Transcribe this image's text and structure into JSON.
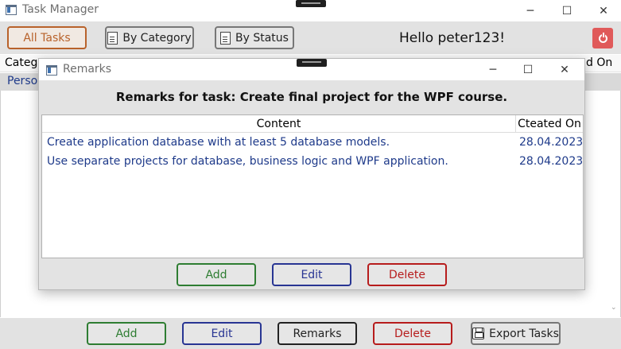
{
  "window": {
    "title": "Task Manager",
    "minimize_glyph": "─",
    "maximize_glyph": "☐",
    "close_glyph": "✕"
  },
  "toolbar": {
    "all_tasks": "All Tasks",
    "by_category": "By Category",
    "by_status": "By Status",
    "greeting": "Hello peter123!"
  },
  "main_grid": {
    "headers": [
      "Categ",
      "d On"
    ],
    "rows": [
      [
        "Person"
      ]
    ]
  },
  "bottom_bar": {
    "add": "Add",
    "edit": "Edit",
    "remarks": "Remarks",
    "delete": "Delete",
    "export": "Export Tasks"
  },
  "dialog": {
    "title": "Remarks",
    "heading": "Remarks for task: Create final project for the WPF course.",
    "columns": [
      "Content",
      "Cteated On"
    ],
    "rows": [
      {
        "content": "Create application database with at least 5 database models.",
        "created_on": "28.04.2023"
      },
      {
        "content": "Use separate projects for database, business logic and WPF application.",
        "created_on": "28.04.2023"
      }
    ],
    "buttons": {
      "add": "Add",
      "edit": "Edit",
      "delete": "Delete"
    }
  },
  "colors": {
    "add": "#2e7d32",
    "edit": "#283593",
    "delete": "#b71c1c",
    "all_tasks": "#b8622b",
    "logout": "#e05a5a",
    "row_text": "#1e3a8a"
  },
  "icons": [
    "app-window-icon",
    "document-icon",
    "power-icon",
    "save-icon"
  ]
}
